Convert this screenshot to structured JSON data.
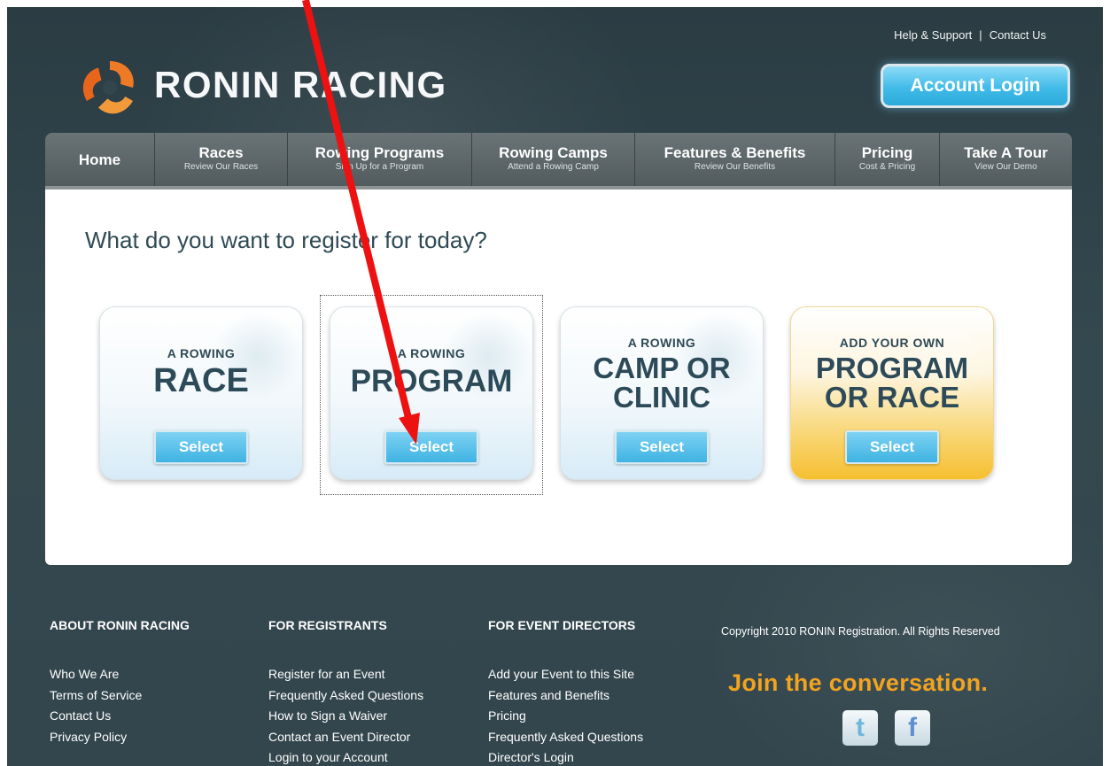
{
  "top_links": {
    "help": "Help & Support",
    "separator": "|",
    "contact": "Contact Us"
  },
  "brand": {
    "name": "RONIN RACING",
    "accent": "#ef7a25"
  },
  "account_login": "Account Login",
  "nav": [
    {
      "title": "Home",
      "subtitle": ""
    },
    {
      "title": "Races",
      "subtitle": "Review Our Races"
    },
    {
      "title": "Rowing Programs",
      "subtitle": "Sign Up for a Program"
    },
    {
      "title": "Rowing Camps",
      "subtitle": "Attend a Rowing Camp"
    },
    {
      "title": "Features & Benefits",
      "subtitle": "Review Our Benefits"
    },
    {
      "title": "Pricing",
      "subtitle": "Cost & Pricing"
    },
    {
      "title": "Take A Tour",
      "subtitle": "View Our Demo"
    }
  ],
  "heading": "What do you want to register for today?",
  "cards": [
    {
      "small": "A ROWING",
      "big1": "RACE",
      "big2": "",
      "button": "Select"
    },
    {
      "small": "A ROWING",
      "big1": "PROGRAM",
      "big2": "",
      "button": "Select"
    },
    {
      "small": "A ROWING",
      "big1": "CAMP OR",
      "big2": "CLINIC",
      "button": "Select"
    },
    {
      "small": "ADD YOUR OWN",
      "big1": "PROGRAM",
      "big2": "OR RACE",
      "button": "Select"
    }
  ],
  "footer": {
    "about": {
      "heading": "ABOUT RONIN RACING",
      "links": [
        "Who We Are",
        "Terms of Service",
        "Contact Us",
        "Privacy Policy"
      ]
    },
    "registrants": {
      "heading": "FOR REGISTRANTS",
      "links": [
        "Register for an Event",
        "Frequently Asked Questions",
        "How to Sign a Waiver",
        "Contact an Event Director",
        "Login to your Account"
      ]
    },
    "directors": {
      "heading": "FOR EVENT DIRECTORS",
      "links": [
        "Add your Event to this Site",
        "Features and Benefits",
        "Pricing",
        "Frequently Asked Questions",
        "Director's Login"
      ]
    },
    "copyright": "Copyright 2010 RONIN Registration. All Rights Reserved",
    "join": "Join the conversation.",
    "social_icons": [
      "twitter-icon",
      "facebook-icon"
    ]
  },
  "annotation_color": "#ee1111"
}
